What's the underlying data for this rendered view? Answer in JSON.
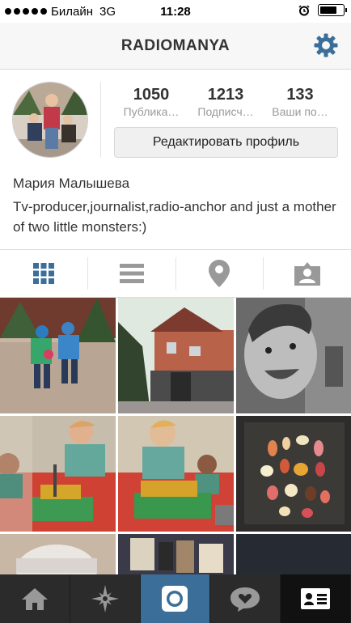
{
  "status_bar": {
    "carrier": "Билайн",
    "network": "3G",
    "time": "11:28",
    "battery_level": 0.75
  },
  "nav": {
    "title": "RADIOMANYA",
    "settings_icon": "gear-icon",
    "accent_color": "#3b6e98"
  },
  "profile": {
    "stats": [
      {
        "value": "1050",
        "label": "Публика…"
      },
      {
        "value": "1213",
        "label": "Подписч…"
      },
      {
        "value": "133",
        "label": "Ваши по…"
      }
    ],
    "edit_button": "Редактировать профиль",
    "name": "Мария Малышева",
    "bio": "Tv-producer,journalist,radio-anchor and just a mother of two little monsters:)"
  },
  "view_tabs": [
    {
      "icon": "grid-icon",
      "active": true
    },
    {
      "icon": "list-icon",
      "active": false
    },
    {
      "icon": "map-pin-icon",
      "active": false
    },
    {
      "icon": "tagged-person-icon",
      "active": false
    }
  ],
  "bottom_tabs": [
    {
      "icon": "home-icon"
    },
    {
      "icon": "explore-icon"
    },
    {
      "icon": "camera-icon",
      "active": true
    },
    {
      "icon": "activity-heart-icon"
    },
    {
      "icon": "profile-card-icon"
    }
  ]
}
